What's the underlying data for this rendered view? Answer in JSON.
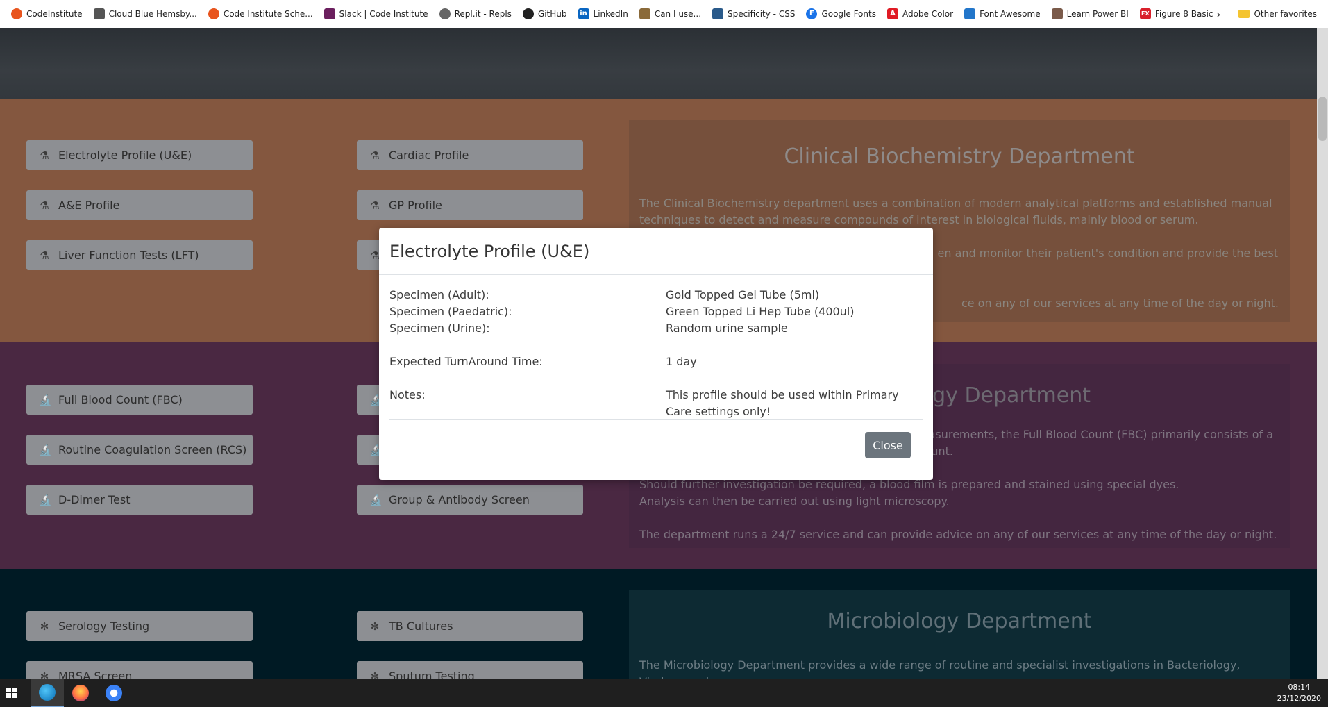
{
  "bookmarks": [
    {
      "label": "CodeInstitute",
      "icon": "codeinstitute-icon",
      "color": "#e8541d"
    },
    {
      "label": "Cloud Blue Hemsby...",
      "icon": "leaf-icon",
      "color": "#555555"
    },
    {
      "label": "Code Institute Sche...",
      "icon": "codeinstitute-icon",
      "color": "#e8541d"
    },
    {
      "label": "Slack | Code Institute",
      "icon": "slack-icon",
      "color": "#6b1f5e"
    },
    {
      "label": "Repl.it - Repls",
      "icon": "replit-icon",
      "color": "#666666"
    },
    {
      "label": "GitHub",
      "icon": "github-icon",
      "color": "#222222"
    },
    {
      "label": "LinkedIn",
      "icon": "linkedin-icon",
      "color": "#0a66c2"
    },
    {
      "label": "Can I use...",
      "icon": "caniuse-icon",
      "color": "#8a6a3a"
    },
    {
      "label": "Specificity - CSS",
      "icon": "css-icon",
      "color": "#2a5a8a"
    },
    {
      "label": "Google Fonts",
      "icon": "google-fonts-icon",
      "color": "#1a73e8"
    },
    {
      "label": "Adobe Color",
      "icon": "adobe-icon",
      "color": "#e01b24"
    },
    {
      "label": "Font Awesome",
      "icon": "flag-icon",
      "color": "#2276ca"
    },
    {
      "label": "Learn Power BI",
      "icon": "avatar-icon",
      "color": "#7a5a4a"
    },
    {
      "label": "Figure 8 Basic",
      "icon": "fx-icon",
      "color": "#d9202b"
    }
  ],
  "bookmarks_overflow": "›",
  "other_favorites": "Other favorites",
  "biochem": {
    "buttons": [
      "Electrolyte Profile (U&E)",
      "Cardiac Profile",
      "A&E Profile",
      "GP Profile",
      "Liver Function Tests (LFT)"
    ],
    "title": "Clinical Biochemistry Department",
    "p1": "The Clinical Biochemistry department uses a combination of modern analytical platforms and established manual techniques to detect and measure compounds of interest in biological fluids, mainly blood or serum.",
    "p2": "en and monitor their patient's condition and provide the best",
    "p3": "ce on any of our services at any time of the day or night."
  },
  "haem": {
    "buttons": [
      "Full Blood Count (FBC)",
      "Routine Coagulation Screen (RCS)",
      "D-Dimer Test",
      "Group & Antibody Screen"
    ],
    "title_fragment": "ogy Department",
    "p1a": "r measurements, the Full Blood Count (FBC) primarily consists of a",
    "p1b": "unt.",
    "p2": "Should further investigation be required, a blood film is prepared and stained using special dyes.",
    "p3": "Analysis can then be carried out using light microscopy.",
    "p4": "The department runs a 24/7 service and can provide advice on any of our services at any time of the day or night."
  },
  "micro": {
    "buttons": [
      "Serology Testing",
      "TB Cultures",
      "MRSA Screen",
      "Sputum Testing"
    ],
    "title": "Microbiology Department",
    "p1": "The Microbiology Department provides a wide range of routine and specialist investigations in Bacteriology, Virology and"
  },
  "modal": {
    "title": "Electrolyte Profile (U&E)",
    "rows": [
      {
        "label": "Specimen (Adult):",
        "value": "Gold Topped Gel Tube (5ml)"
      },
      {
        "label": "Specimen (Paedatric):",
        "value": "Green Topped Li Hep Tube (400ul)"
      },
      {
        "label": "Specimen (Urine):",
        "value": "Random urine sample"
      },
      {
        "label": "Expected TurnAround Time:",
        "value": "1 day"
      },
      {
        "label": "Notes:",
        "value": "This profile should be used within Primary Care settings only!"
      }
    ],
    "close_label": "Close"
  },
  "taskbar": {
    "apps": [
      "edge-icon",
      "firefox-icon",
      "chromium-icon"
    ],
    "time": "08:14",
    "date": "23/12/2020"
  },
  "colors": {
    "biochem_bg": "#84573f",
    "haem_bg": "#4a2842",
    "micro_bg": "#001a24",
    "button_bg": "#8d8f93",
    "close_button": "#6c757d"
  }
}
